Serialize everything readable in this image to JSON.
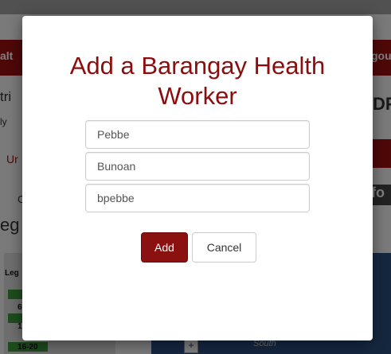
{
  "background": {
    "nav_left_fragment": "alt",
    "nav_right_fragment": "gou",
    "left_fragments": [
      "tri",
      "ly",
      "Ur",
      "C",
      "eg"
    ],
    "right_fragment_1": "DP",
    "right_fragment_2": "t fo",
    "legend_label": "Leg",
    "legend_row_1": "6",
    "legend_row_2": "1",
    "legend_row_3": "16-20",
    "map_zoom_label": "+",
    "map_compass_label": "South"
  },
  "modal": {
    "title": "Add a Barangay Health Worker",
    "fields": [
      {
        "value": "Pebbe"
      },
      {
        "value": "Bunoan"
      },
      {
        "value": "bpebbe"
      }
    ],
    "add_label": "Add",
    "cancel_label": "Cancel"
  },
  "colors": {
    "accent": "#8b1010",
    "title": "#8b0d0d"
  }
}
